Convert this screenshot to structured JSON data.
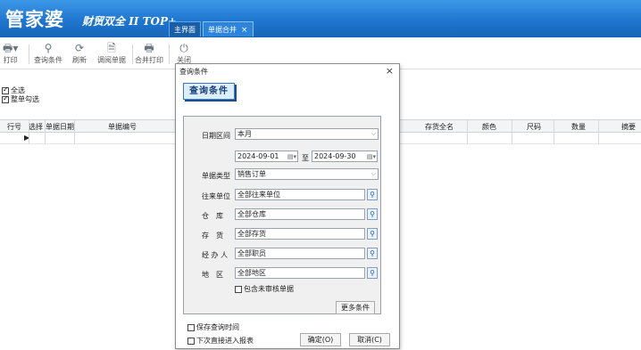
{
  "app": {
    "logo": "管家婆",
    "logo_sub": "财贸双全 II TOP+"
  },
  "tabs": [
    {
      "label": "主界面"
    },
    {
      "label": "单据合并",
      "close": "×"
    }
  ],
  "toolbar": {
    "print": "打印",
    "query": "查询条件",
    "refresh": "刷新",
    "view_doc": "调阅单据",
    "merge_print": "合并打印",
    "close": "关闭"
  },
  "options": {
    "select_all": "全选",
    "single_check": "整单勾选"
  },
  "grid": {
    "columns": [
      "行号",
      "选择",
      "单据日期",
      "单据编号",
      "存货全名",
      "颜色",
      "尺码",
      "数量",
      "摘要"
    ],
    "row_indicator": "▶"
  },
  "dialog": {
    "title": "查询条件",
    "close": "×",
    "header": "查询条件",
    "date_range_label": "日期区间",
    "date_range_value": "本月",
    "date_from": "2024-09-01",
    "date_to_label": "至",
    "date_to": "2024-09-30",
    "doc_type_label": "单据类型",
    "doc_type_value": "销售订单",
    "partner_label": "往来单位",
    "partner_value": "全部往来单位",
    "warehouse_label": "仓　库",
    "warehouse_value": "全部仓库",
    "stock_label": "存　货",
    "stock_value": "全部存货",
    "handler_label": "经 办 人",
    "handler_value": "全部职员",
    "region_label": "地　区",
    "region_value": "全部地区",
    "include_unaudited": "包含未审核单据",
    "more_conditions": "更多条件",
    "save_query_time": "保存查询时间",
    "direct_report": "下次直接进入报表",
    "ok": "确定(O)",
    "cancel": "取消(C)"
  }
}
